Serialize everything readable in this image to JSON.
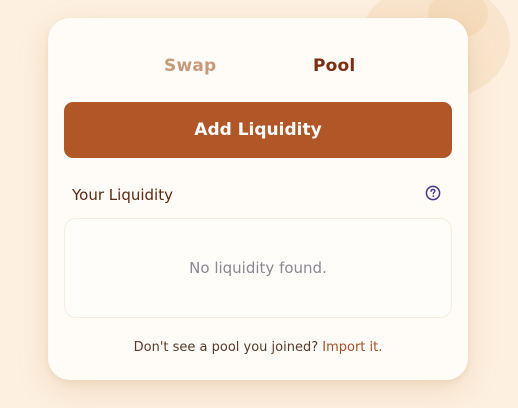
{
  "tabs": [
    {
      "label": "Swap",
      "active": false
    },
    {
      "label": "Pool",
      "active": true
    }
  ],
  "add_button": {
    "label": "Add Liquidity"
  },
  "liquidity": {
    "heading": "Your Liquidity",
    "help_icon": "question-circle-icon",
    "empty_message": "No liquidity found."
  },
  "footer": {
    "prompt": "Don't see a pool you joined?",
    "link": "Import it."
  },
  "colors": {
    "background": "#fdf0e0",
    "card": "#fffcf7",
    "accent": "#b05627",
    "active_tab": "#7a2e14",
    "inactive_tab": "#c79a7b",
    "help_icon": "#4b3a8c"
  }
}
